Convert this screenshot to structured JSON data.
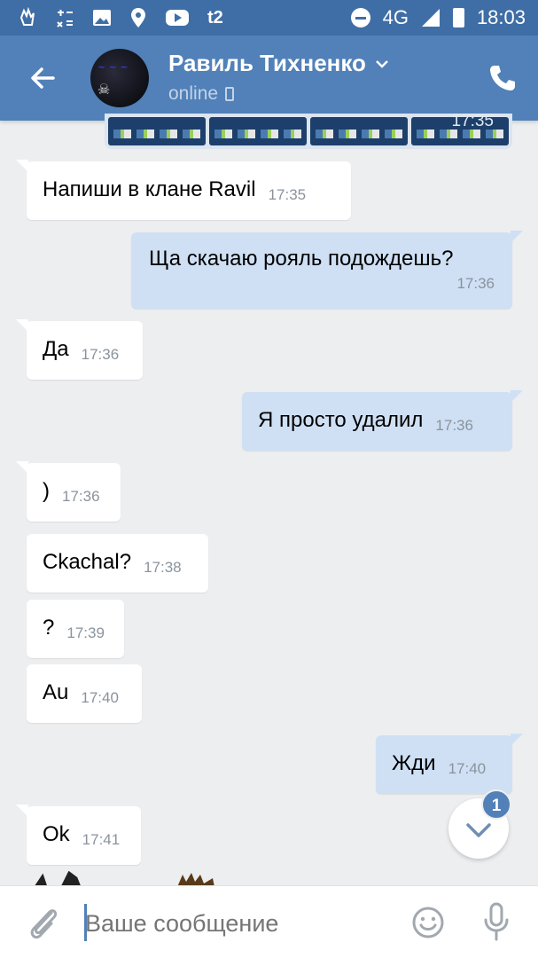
{
  "status_bar": {
    "left_icons": [
      "hand-icon",
      "calculator-icon",
      "gallery-icon",
      "location-icon",
      "youtube-icon"
    ],
    "carrier": "t2",
    "network": "4G",
    "network_small": "4G",
    "time": "18:03"
  },
  "header": {
    "contact_name": "Равиль Тихненко",
    "status": "online"
  },
  "top_image": {
    "time": "17:35"
  },
  "messages": [
    {
      "dir": "in",
      "text": "Напиши в клане Ravil",
      "time": "17:35"
    },
    {
      "dir": "out",
      "text": "Ща скачаю рояль подождешь?",
      "time": "17:36"
    },
    {
      "dir": "in",
      "text": "Да",
      "time": "17:36"
    },
    {
      "dir": "out",
      "text": "Я просто удалил",
      "time": "17:36"
    },
    {
      "dir": "in",
      "text": ")",
      "time": "17:36"
    },
    {
      "dir": "in",
      "text": "Ckachal?",
      "time": "17:38"
    },
    {
      "dir": "in",
      "text": "?",
      "time": "17:39"
    },
    {
      "dir": "in",
      "text": "Au",
      "time": "17:40"
    },
    {
      "dir": "out",
      "text": "Жди",
      "time": "17:40"
    },
    {
      "dir": "in",
      "text": "Ok",
      "time": "17:41"
    }
  ],
  "scroll_down": {
    "badge": "1"
  },
  "composer": {
    "placeholder": "Ваше сообщение"
  },
  "colors": {
    "statusbar": "#3f6ea6",
    "header": "#5181b8",
    "background": "#edeef0",
    "incoming": "#ffffff",
    "outgoing": "#cfe0f4"
  }
}
